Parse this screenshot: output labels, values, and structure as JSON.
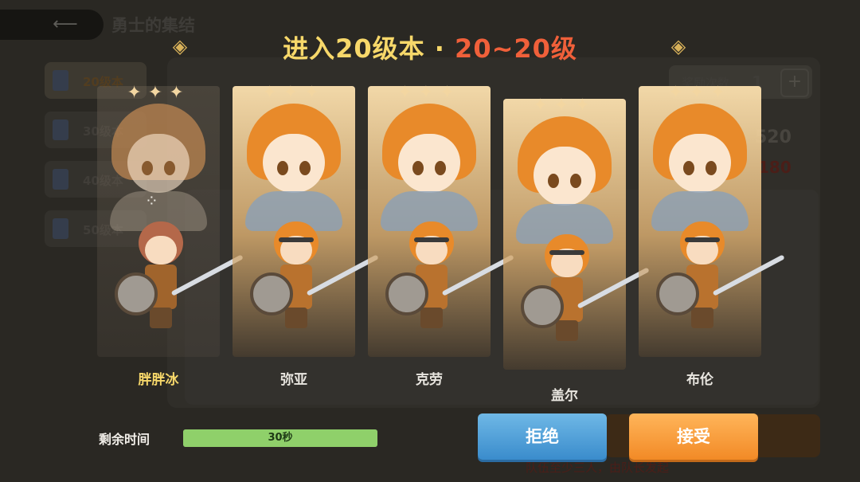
{
  "background_screen": {
    "title": "勇士的集结",
    "back_icon": "back-arrow-icon",
    "level_tabs": [
      {
        "label": "20级本",
        "active": true
      },
      {
        "label": "30级本",
        "active": false
      },
      {
        "label": "40级本",
        "active": false
      },
      {
        "label": "50级本",
        "active": false
      }
    ],
    "reward_count_label": "奖励次数",
    "reward_count_value": "1",
    "plus_label": "+",
    "num_a": "520",
    "num_b": "180",
    "hint": "队伍至少三人，由队长发起"
  },
  "popup": {
    "title_main": "进入20级本 · ",
    "title_range": "20~20级",
    "members": [
      {
        "name": "胖胖冰",
        "is_self": true,
        "loading": true
      },
      {
        "name": "弥亚",
        "is_self": false
      },
      {
        "name": "克劳",
        "is_self": false
      },
      {
        "name": "盖尔",
        "is_self": false
      },
      {
        "name": "布伦",
        "is_self": false
      }
    ],
    "timer_label": "剩余时间",
    "timer_text": "30秒",
    "timer_fraction": 1.0,
    "reject_label": "拒绝",
    "accept_label": "接受",
    "colors": {
      "title": "#f7d86a",
      "range": "#f0603a",
      "reject": "#3a8ccc",
      "accept": "#f28a26",
      "timer": "#8fd06a"
    }
  }
}
